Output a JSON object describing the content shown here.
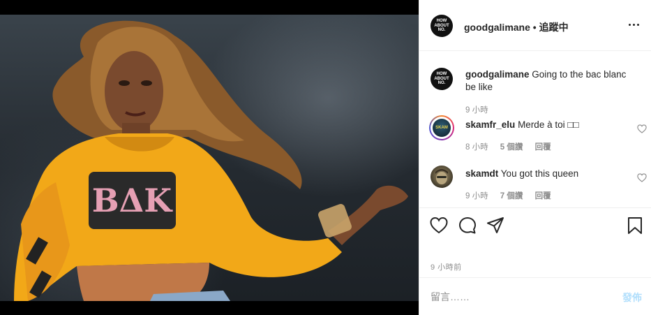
{
  "post": {
    "author": "goodgalimane",
    "separator": "•",
    "follow_status": "追蹤中",
    "avatar_text": [
      "HOW",
      "ABOUT",
      "NO."
    ],
    "caption_user": "goodgalimane",
    "caption_text": "Going to the bac blanc be like",
    "caption_time": "9 小時",
    "posted_time": "9 小時前"
  },
  "comments": [
    {
      "user": "skamfr_elu",
      "text": "Merde à toi □□",
      "time": "8 小時",
      "likes": "5 個讚",
      "reply": "回覆",
      "avatar_text": "SKAM"
    },
    {
      "user": "skamdt",
      "text": "You got this queen",
      "time": "9 小時",
      "likes": "7 個讚",
      "reply": "回覆"
    }
  ],
  "composer": {
    "placeholder": "留言……",
    "post_label": "發佈"
  },
  "icons": {
    "like": "heart-icon",
    "comment": "comment-bubble-icon",
    "share": "paper-plane-icon",
    "save": "bookmark-icon",
    "more": "more-options-icon"
  },
  "colors": {
    "text": "#262626",
    "muted": "#8e8e8e",
    "post_button_disabled": "#b2dffc",
    "border": "#efefef"
  }
}
